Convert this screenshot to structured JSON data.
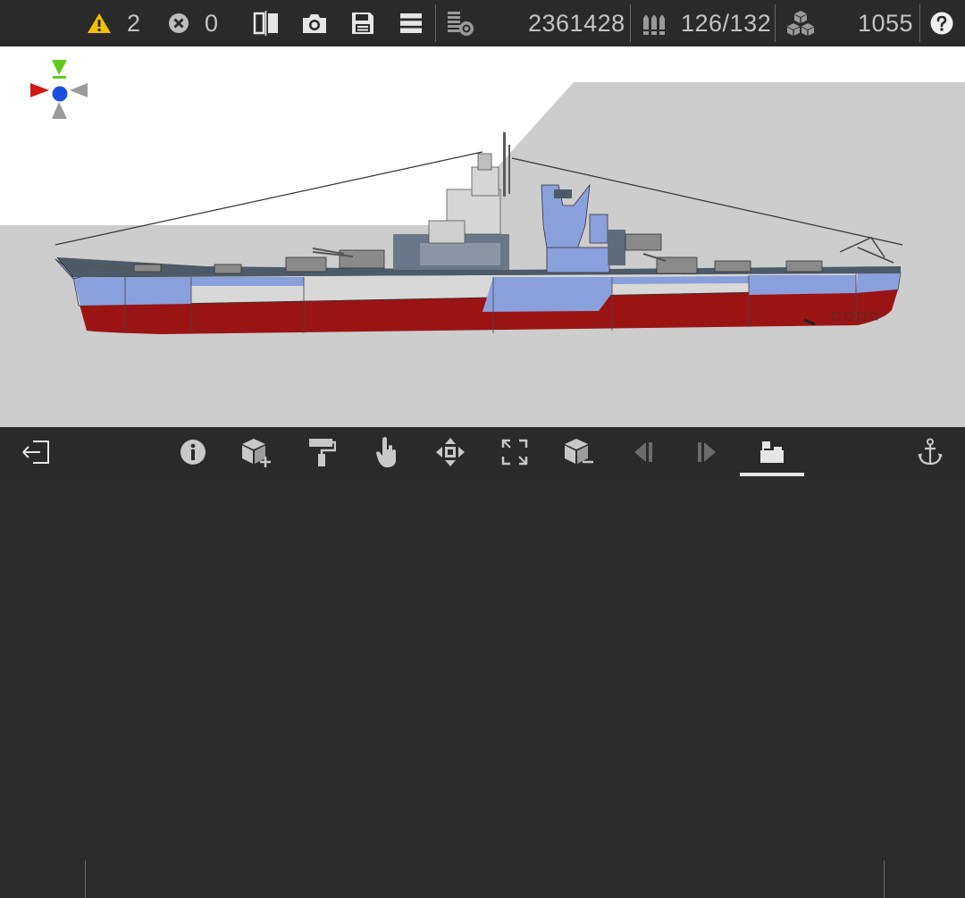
{
  "toolbar": {
    "warnings_count": "2",
    "errors_count": "0",
    "ship_cost": "2361428",
    "ammo": "126/132",
    "parts_count": "1055"
  },
  "icons": {
    "warning": "warning-triangle-icon",
    "error": "error-circle-x-icon",
    "mirror": "mirror-split-icon",
    "camera": "camera-icon",
    "save": "floppy-disk-icon",
    "menu": "hamburger-menu-icon",
    "cost": "coin-stack-icon",
    "ammo": "ammo-shells-icon",
    "parts": "cubes-stack-icon",
    "help": "help-question-icon"
  },
  "bottom_tools": [
    "exit-icon",
    "info-icon",
    "add-part-icon",
    "paint-roller-icon",
    "hand-select-icon",
    "move-arrows-icon",
    "resize-icon",
    "remove-part-icon",
    "previous-icon",
    "next-icon",
    "ship-view-icon",
    "anchor-icon"
  ],
  "colors": {
    "bar_bg": "#2a2a2a",
    "warning_yellow": "#f2c200",
    "hull_red": "#9a1414",
    "hull_blue": "#8aa0dc",
    "deck": "#4d5a68",
    "gizmo_green": "#5ecb1c",
    "gizmo_red": "#d01818",
    "gizmo_blue": "#1a50e0"
  }
}
